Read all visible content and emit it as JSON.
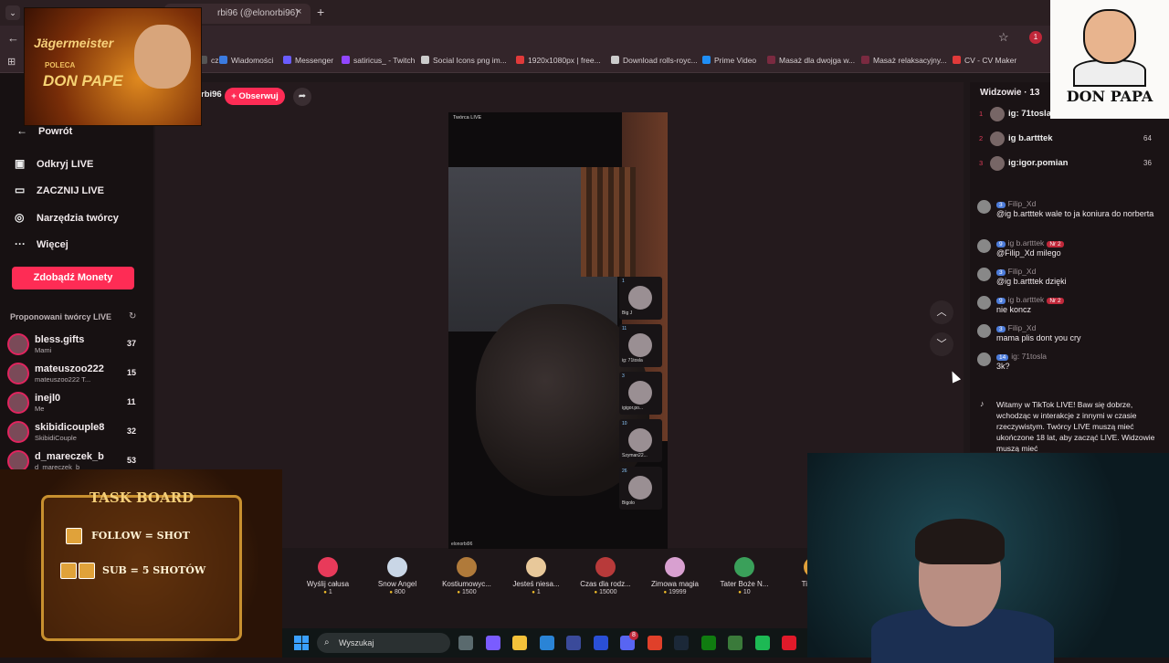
{
  "browser": {
    "tab_title": "rbi96 (@elonorbi96)",
    "new_tab": "+",
    "tab_close": "×",
    "back": "←",
    "bookmarks": [
      {
        "label": "cz",
        "color": "#555555"
      },
      {
        "label": "Wiadomości",
        "color": "#3b7be0"
      },
      {
        "label": "Messenger",
        "color": "#6a5cff"
      },
      {
        "label": "satiricus_ - Twitch",
        "color": "#9146ff"
      },
      {
        "label": "Social Icons png im...",
        "color": "#cccccc"
      },
      {
        "label": "1920x1080px | free...",
        "color": "#e03a3a"
      },
      {
        "label": "Download rolls-royc...",
        "color": "#cccccc"
      },
      {
        "label": "Prime Video",
        "color": "#1f8ef5"
      },
      {
        "label": "Masaż dla dwojga w...",
        "color": "#7a2a40"
      },
      {
        "label": "Masaż relaksacyjny...",
        "color": "#7a2a40"
      },
      {
        "label": "CV - CV Maker",
        "color": "#e03a3a"
      }
    ],
    "ext_badge": "1"
  },
  "sidebar": {
    "back_label": "Powrót",
    "items": [
      {
        "label": "Odkryj LIVE",
        "icon": "calendar-icon"
      },
      {
        "label": "ZACZNIJ LIVE",
        "icon": "camera-icon"
      },
      {
        "label": "Narzędzia twórcy",
        "icon": "lightbulb-icon"
      },
      {
        "label": "Więcej",
        "icon": "more-icon"
      }
    ],
    "coins_button": "Zdobądź Monety",
    "suggested_title": "Proponowani twórcy LIVE",
    "creators": [
      {
        "name": "bless.gifts",
        "sub": "Mami",
        "count": "37"
      },
      {
        "name": "mateuszoo222",
        "sub": "mateuszoo222 T...",
        "count": "15"
      },
      {
        "name": "inejl0",
        "sub": "Me",
        "count": "11"
      },
      {
        "name": "skibidicouple8",
        "sub": "SkibidiCouple",
        "count": "32"
      },
      {
        "name": "d_mareczek_b",
        "sub": "d_mareczek_b",
        "count": "53"
      }
    ]
  },
  "stream": {
    "host": "rbi96",
    "follow_button": "+ Obserwuj",
    "video_label": "Twórca LIVE",
    "video_user": "elonorbi96",
    "guests": [
      {
        "level": "1",
        "name": "Big J"
      },
      {
        "level": "11",
        "name": "ig: 71tosla"
      },
      {
        "level": "3",
        "name": "igigor.po..."
      },
      {
        "level": "10",
        "name": "Szyman22..."
      },
      {
        "level": "26",
        "name": "Bigolo"
      }
    ]
  },
  "gifts": [
    {
      "name": "Wyślij całusa",
      "price": "1",
      "color": "#e83a5a"
    },
    {
      "name": "Snow Angel",
      "price": "800",
      "color": "#c9d6e6"
    },
    {
      "name": "Kostiumowyc...",
      "price": "1500",
      "color": "#b07a3a"
    },
    {
      "name": "Jesteś niesa...",
      "price": "1",
      "color": "#e8c89a"
    },
    {
      "name": "Czas dla rodz...",
      "price": "15000",
      "color": "#b83a3a"
    },
    {
      "name": "Zimowa magia",
      "price": "19999",
      "color": "#d8a0d0"
    },
    {
      "name": "Tater Boże N...",
      "price": "10",
      "color": "#3aa05a"
    },
    {
      "name": "Tiny Bo",
      "price": "",
      "color": "#e0a03a"
    }
  ],
  "chat": {
    "viewers_title": "Widzowie · 13",
    "ranking": [
      {
        "rank": "1",
        "name": "ig: 71tosla",
        "score": ""
      },
      {
        "rank": "2",
        "name": "ig b.artttek",
        "score": "64"
      },
      {
        "rank": "3",
        "name": "ig:igor.pomian",
        "score": "36"
      }
    ],
    "messages": [
      {
        "level": "3",
        "user": "Filip_Xd",
        "badge": "",
        "text": "@ig b.artttek wale to ja koniura do norberta"
      },
      {
        "level": "9",
        "user": "ig b.artttek",
        "badge": "Nr 2",
        "text": "@Filip_Xd milego"
      },
      {
        "level": "3",
        "user": "Filip_Xd",
        "badge": "",
        "text": "@ig b.artttek dzięki"
      },
      {
        "level": "9",
        "user": "ig b.artttek",
        "badge": "Nr 2",
        "text": "nie koncz"
      },
      {
        "level": "3",
        "user": "Filip_Xd",
        "badge": "",
        "text": "mama plis dont you cry"
      },
      {
        "level": "14",
        "user": "ig: 71tosla",
        "badge": "",
        "text": "3k?"
      }
    ],
    "welcome": "Witamy w TikTok LIVE! Baw się dobrze, wchodząc w interakcje z innymi w czasie rzeczywistym. Twórcy LIVE muszą mieć ukończone 18 lat, aby zacząć LIVE. Widzowie muszą mieć"
  },
  "overlays": {
    "jager_brand": "Jägermeister",
    "jager_poleca": "POLECA",
    "jager_name": "DON PAPE",
    "donpapa": "DON PAPA",
    "taskboard_title": "TASK BOARD",
    "taskboard_row1": "FOLLOW = SHOT",
    "taskboard_row2": "SUB = 5 SHOTÓW"
  },
  "taskbar": {
    "search_placeholder": "Wyszukaj",
    "discord_badge": "8",
    "apps": [
      {
        "icon": "task-view-icon",
        "color": "#5a6a6e"
      },
      {
        "icon": "copilot-icon",
        "color": "#7a5cff"
      },
      {
        "icon": "explorer-icon",
        "color": "#f3c13a"
      },
      {
        "icon": "store-icon",
        "color": "#2a84d6"
      },
      {
        "icon": "vpn-icon",
        "color": "#3a4a9a"
      },
      {
        "icon": "l-app-icon",
        "color": "#2a4fd6"
      },
      {
        "icon": "discord-icon",
        "color": "#5865f2"
      },
      {
        "icon": "chrome-icon",
        "color": "#e0402a"
      },
      {
        "icon": "steam-icon",
        "color": "#1b2838"
      },
      {
        "icon": "xbox-icon",
        "color": "#107c10"
      },
      {
        "icon": "minecraft-icon",
        "color": "#3a7a3a"
      },
      {
        "icon": "spotify-icon",
        "color": "#1db954"
      },
      {
        "icon": "opera-icon",
        "color": "#e01a2a"
      }
    ]
  }
}
